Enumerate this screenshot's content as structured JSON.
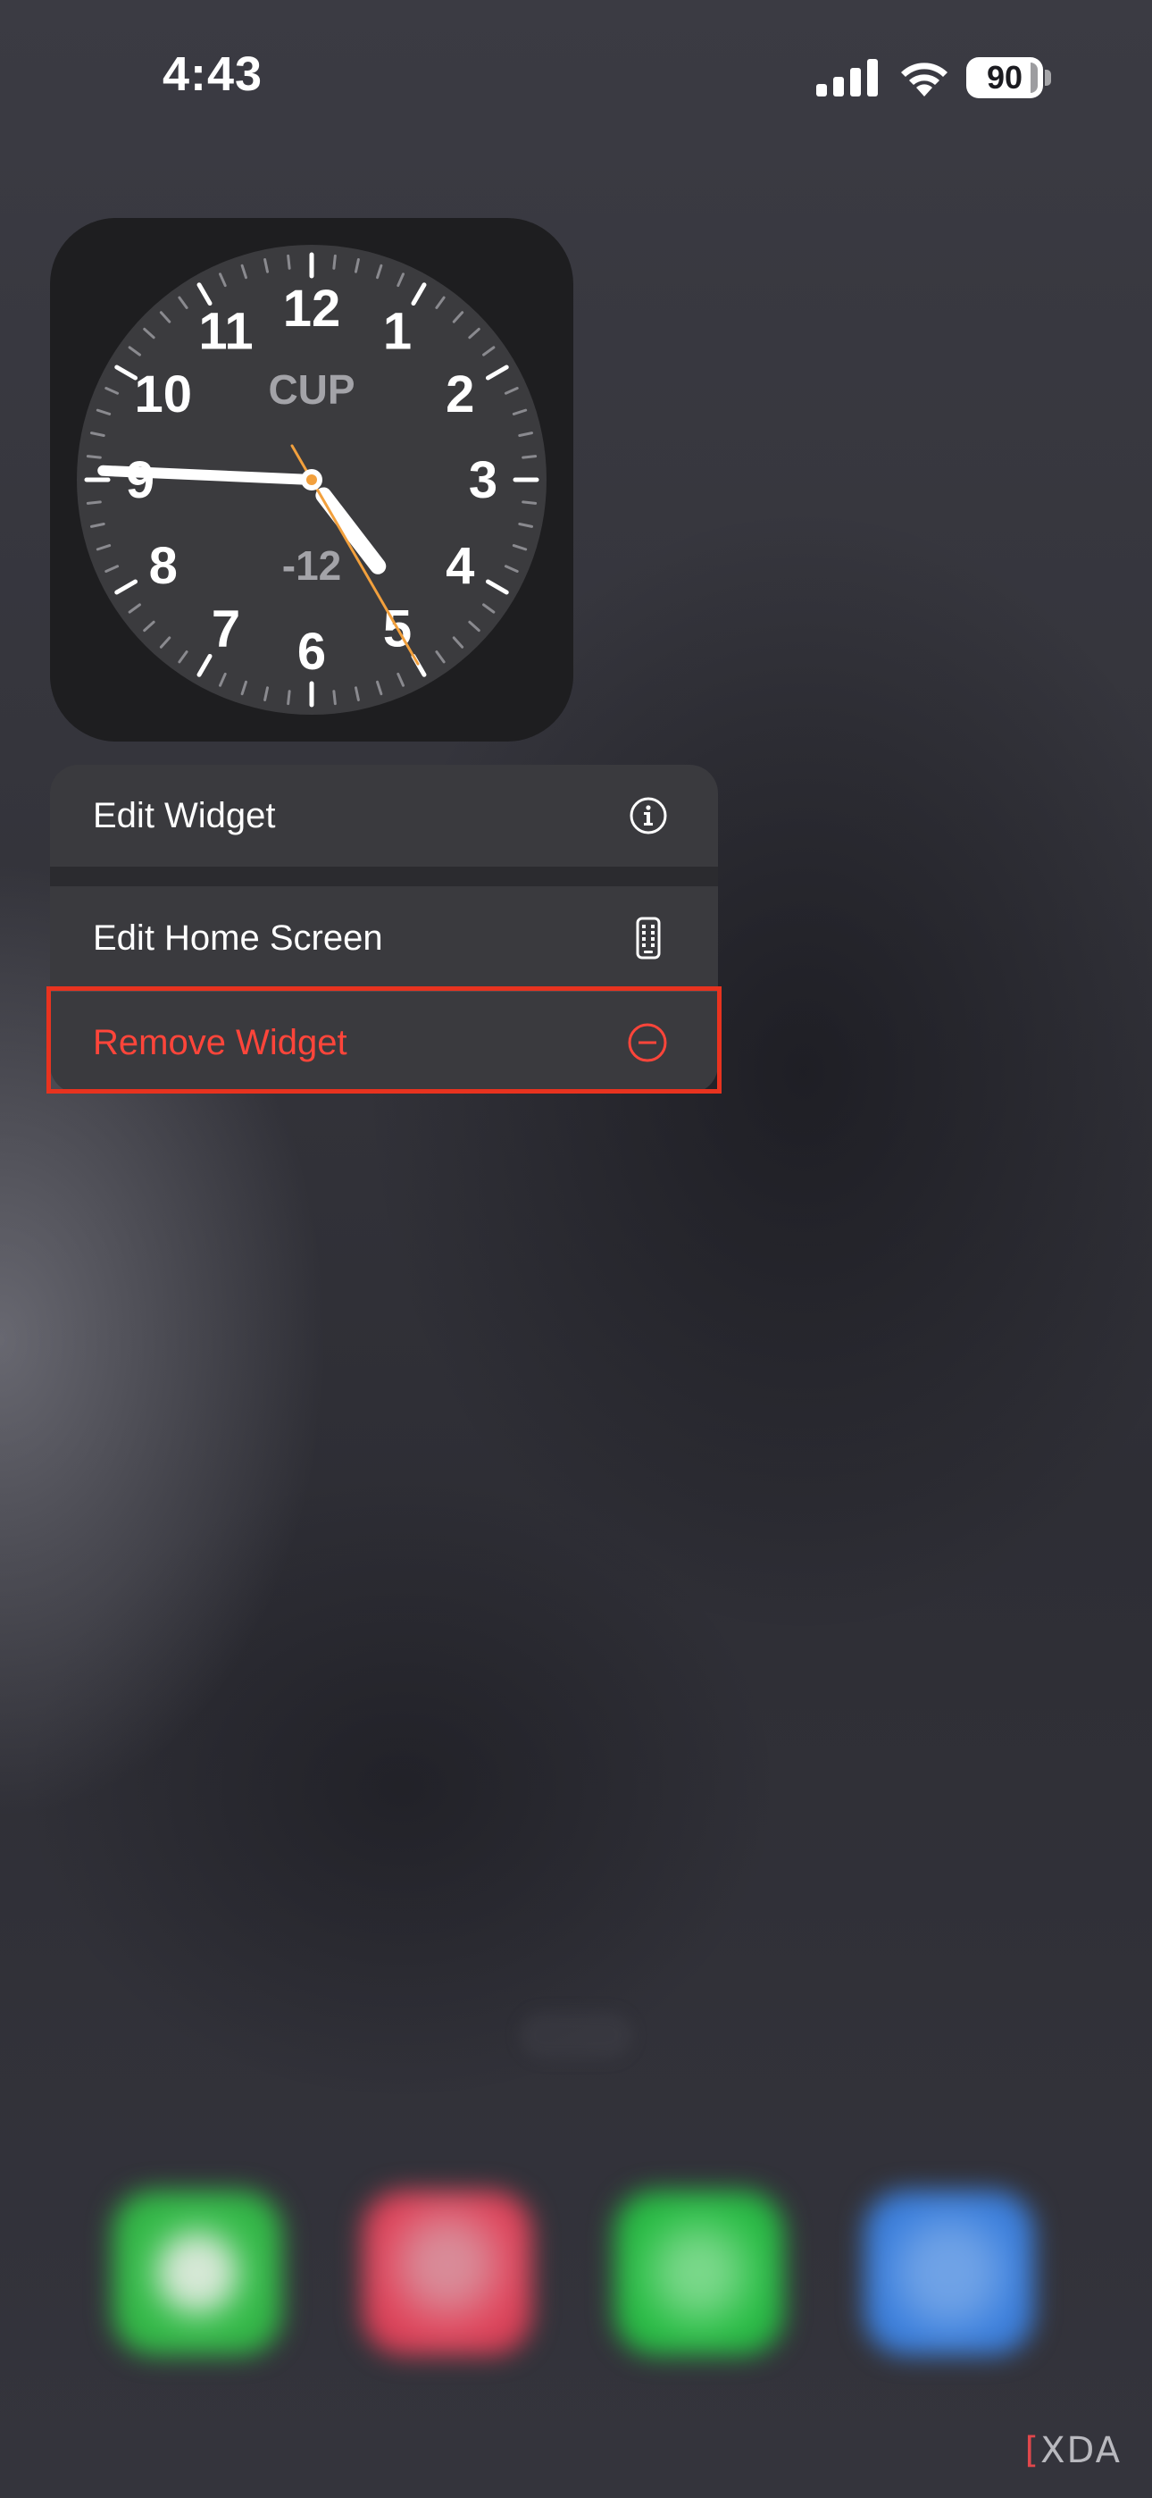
{
  "status_bar": {
    "time": "4:43",
    "battery_level": "90",
    "icons": [
      "cellular-signal-icon",
      "wifi-icon",
      "battery-icon"
    ]
  },
  "widget": {
    "type": "world-clock",
    "city": "CUP",
    "offset": "-12",
    "numerals": [
      "12",
      "1",
      "2",
      "3",
      "4",
      "5",
      "6",
      "7",
      "8",
      "9",
      "10",
      "11"
    ],
    "time_shown": {
      "hour": 4,
      "minute": 45,
      "second": 25
    },
    "second_hand_color": "#f2a03d"
  },
  "context_menu": {
    "items": [
      {
        "label": "Edit Widget",
        "icon": "info-icon"
      },
      {
        "label": "Edit Home Screen",
        "icon": "phone-icon"
      },
      {
        "label": "Remove Widget",
        "icon": "minus-circle-icon",
        "destructive": true
      }
    ],
    "destructive_color": "#ff453a",
    "highlight_color": "#e8331f"
  },
  "dock": {
    "apps": [
      {
        "icon": "messages-app-icon",
        "color": "#3bbf4f"
      },
      {
        "icon": "music-app-icon",
        "color": "#e04a60"
      },
      {
        "icon": "phone-app-icon",
        "color": "#2fbf4a"
      },
      {
        "icon": "safari-app-icon",
        "color": "#3f82de"
      }
    ]
  },
  "watermark": {
    "bracket": "[",
    "text": "XDA"
  }
}
